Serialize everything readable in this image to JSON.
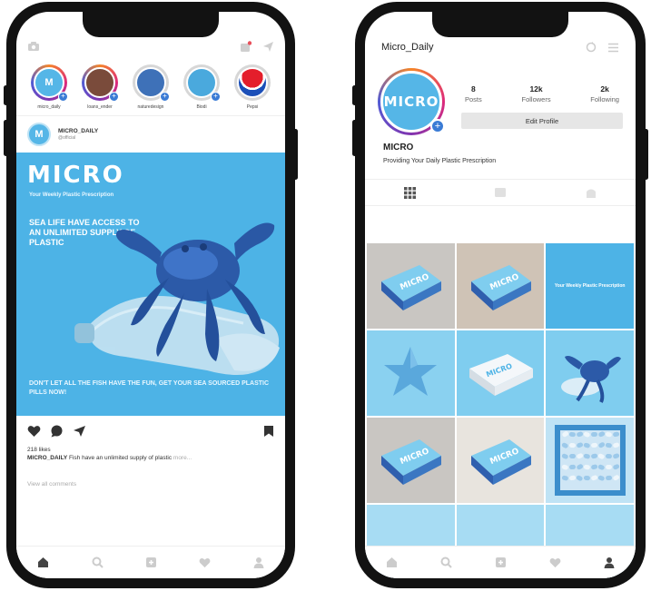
{
  "feed": {
    "stories": [
      {
        "name": "micro_daily",
        "initials": "M",
        "color": "#55b6e7",
        "ring": "gradient"
      },
      {
        "name": "loans_ender",
        "initials": "",
        "color": "#7a4b3b",
        "ring": "gradient"
      },
      {
        "name": "naturedesign",
        "initials": "",
        "color": "#3e71b8",
        "ring": "plain"
      },
      {
        "name": "Biodi",
        "initials": "",
        "color": "#4aa9dd",
        "ring": "plain"
      },
      {
        "name": "Pepsi",
        "initials": "",
        "color": "#ffffff",
        "ring": "plain"
      }
    ],
    "post": {
      "username": "MICRO_DAILY",
      "subtitle": "@official",
      "brand": "MICRO",
      "brand_sub": "Your Weekly Plastic Prescription",
      "headline": "SEA LIFE HAVE ACCESS TO AN UNLIMITED SUPPLY OF PLASTIC",
      "footer": "DON'T LET ALL THE FISH HAVE THE FUN, GET YOUR SEA SOURCED PLASTIC PILLS NOW!",
      "likes": "218 likes",
      "caption_user": "MICRO_DAILY",
      "caption_text": " Fish have an unlimited supply of plastic",
      "caption_more": " more...",
      "comments": "View all comments"
    }
  },
  "profile": {
    "username": "Micro_Daily",
    "avatar_text": "MICRO",
    "stats": [
      {
        "value": "8",
        "label": "Posts"
      },
      {
        "value": "12k",
        "label": "Followers"
      },
      {
        "value": "2k",
        "label": "Following"
      }
    ],
    "edit_label": "Edit Profile",
    "name": "MICRO",
    "bio": "Providing Your Daily Plastic Prescription",
    "grid": [
      {
        "kind": "box-dark"
      },
      {
        "kind": "box-dark"
      },
      {
        "kind": "caption",
        "text": "Your Weekly Plastic Prescription"
      },
      {
        "kind": "star"
      },
      {
        "kind": "box-white"
      },
      {
        "kind": "crab"
      },
      {
        "kind": "box-grey"
      },
      {
        "kind": "box-dark"
      },
      {
        "kind": "pills"
      },
      {
        "kind": "plain"
      },
      {
        "kind": "plain"
      },
      {
        "kind": "plain"
      }
    ]
  },
  "colors": {
    "brand_blue": "#4db3e6",
    "light_blue": "#7fcdef",
    "dark_blue": "#2f5fae",
    "ig_blue": "#3a7bd5"
  }
}
